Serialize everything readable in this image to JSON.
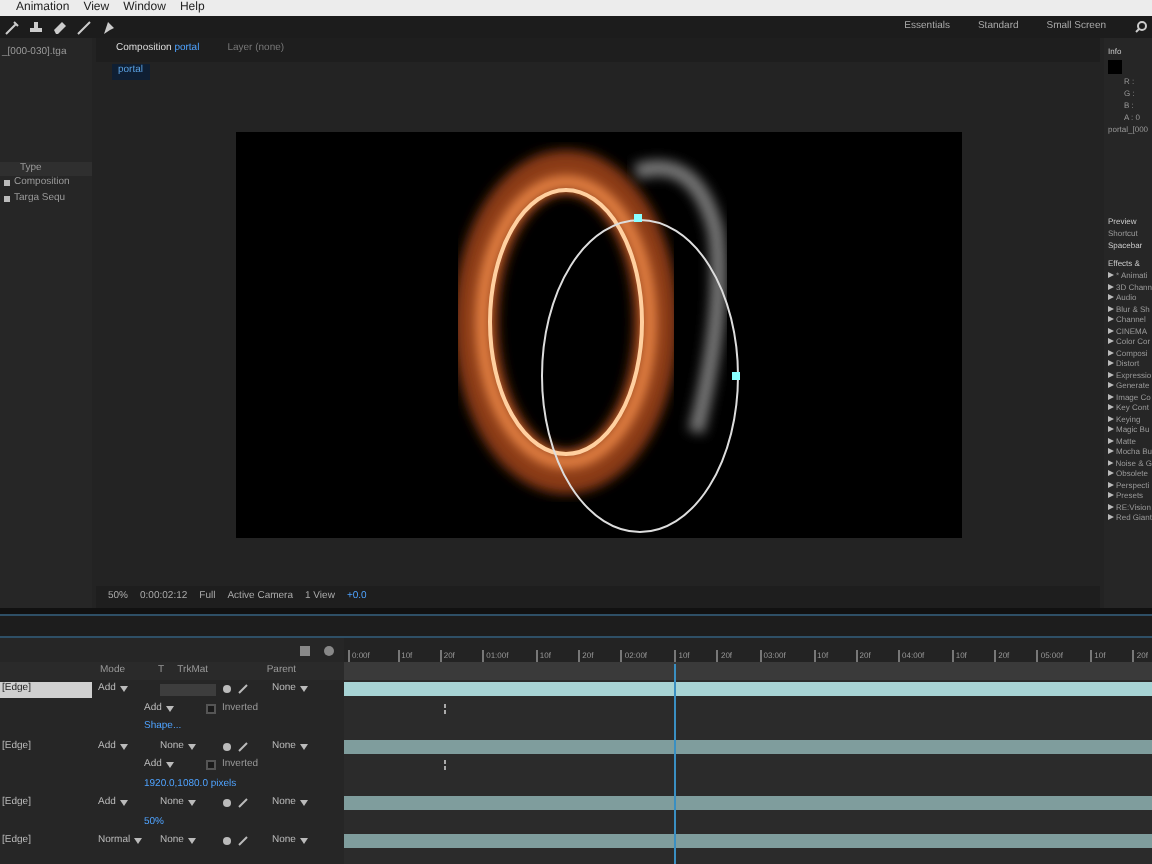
{
  "menu": [
    "Animation",
    "View",
    "Window",
    "Help"
  ],
  "workspaces": [
    {
      "label": "Essentials",
      "selected": false
    },
    {
      "label": "Standard",
      "selected": false
    },
    {
      "label": "Small Screen",
      "selected": false
    }
  ],
  "project_panel": {
    "title": "_[000-030].tga",
    "column": "Type",
    "items": [
      {
        "label": "Composition",
        "selected": false
      },
      {
        "label": "Targa Sequ",
        "selected": false
      }
    ]
  },
  "comp_tabs": [
    {
      "label": "Composition",
      "name": "portal",
      "selected": true
    },
    {
      "label": "Layer (none)",
      "selected": false
    }
  ],
  "breadcrumb": "portal",
  "viewer_bar": {
    "zoom": "50%",
    "timecode": "0:00:02:12",
    "resolution": "Full",
    "camera": "Active Camera",
    "views": "1 View",
    "exposure": "+0.0"
  },
  "right_panel": {
    "info_title": "Info",
    "info_lines": [
      "R :",
      "G :",
      "B :",
      "A : 0"
    ],
    "info_name": "portal_[000",
    "preview_title": "Preview",
    "shortcut_label": "Shortcut",
    "shortcut": "Spacebar",
    "effects_title": "Effects &",
    "effects": [
      "* Animati",
      "3D Chann",
      "Audio",
      "Blur & Sh",
      "Channel",
      "CINEMA",
      "Color Cor",
      "Composi",
      "Distort",
      "Expressio",
      "Generate",
      "Image Co",
      "Key Cont",
      "Keying",
      "Magic Bu",
      "Matte",
      "Mocha Bu",
      "Noise & G",
      "Obsolete",
      "Perspecti",
      "Presets",
      "RE:Vision",
      "Red Giant"
    ]
  },
  "timeline": {
    "columns": [
      "Mode",
      "T",
      "TrkMat",
      "Parent"
    ],
    "ruler": [
      "0:00f",
      "10f",
      "20f",
      "01:00f",
      "10f",
      "20f",
      "02:00f",
      "10f",
      "20f",
      "03:00f",
      "10f",
      "20f",
      "04:00f",
      "10f",
      "20f",
      "05:00f",
      "10f",
      "20f"
    ],
    "playhead": {
      "level": 0.41
    },
    "rows": [
      {
        "kind": "layer",
        "name": "[Edge]",
        "mode": "Add",
        "trkmat": "",
        "parent": "None",
        "selected": true
      },
      {
        "kind": "mask",
        "mode": "Add",
        "inverted": false,
        "label": "Inverted"
      },
      {
        "kind": "value",
        "value": "Shape..."
      },
      {
        "kind": "layer",
        "name": "[Edge]",
        "mode": "Add",
        "trkmat": "None",
        "parent": "None",
        "selected": false
      },
      {
        "kind": "mask",
        "mode": "Add",
        "inverted": false,
        "label": "Inverted"
      },
      {
        "kind": "value",
        "value": "1920.0,1080.0 pixels"
      },
      {
        "kind": "layer",
        "name": "[Edge]",
        "mode": "Add",
        "trkmat": "None",
        "parent": "None",
        "selected": false
      },
      {
        "kind": "value",
        "value": "50%"
      },
      {
        "kind": "layer",
        "name": "[Edge]",
        "mode": "Normal",
        "trkmat": "None",
        "parent": "None",
        "selected": false
      }
    ]
  }
}
